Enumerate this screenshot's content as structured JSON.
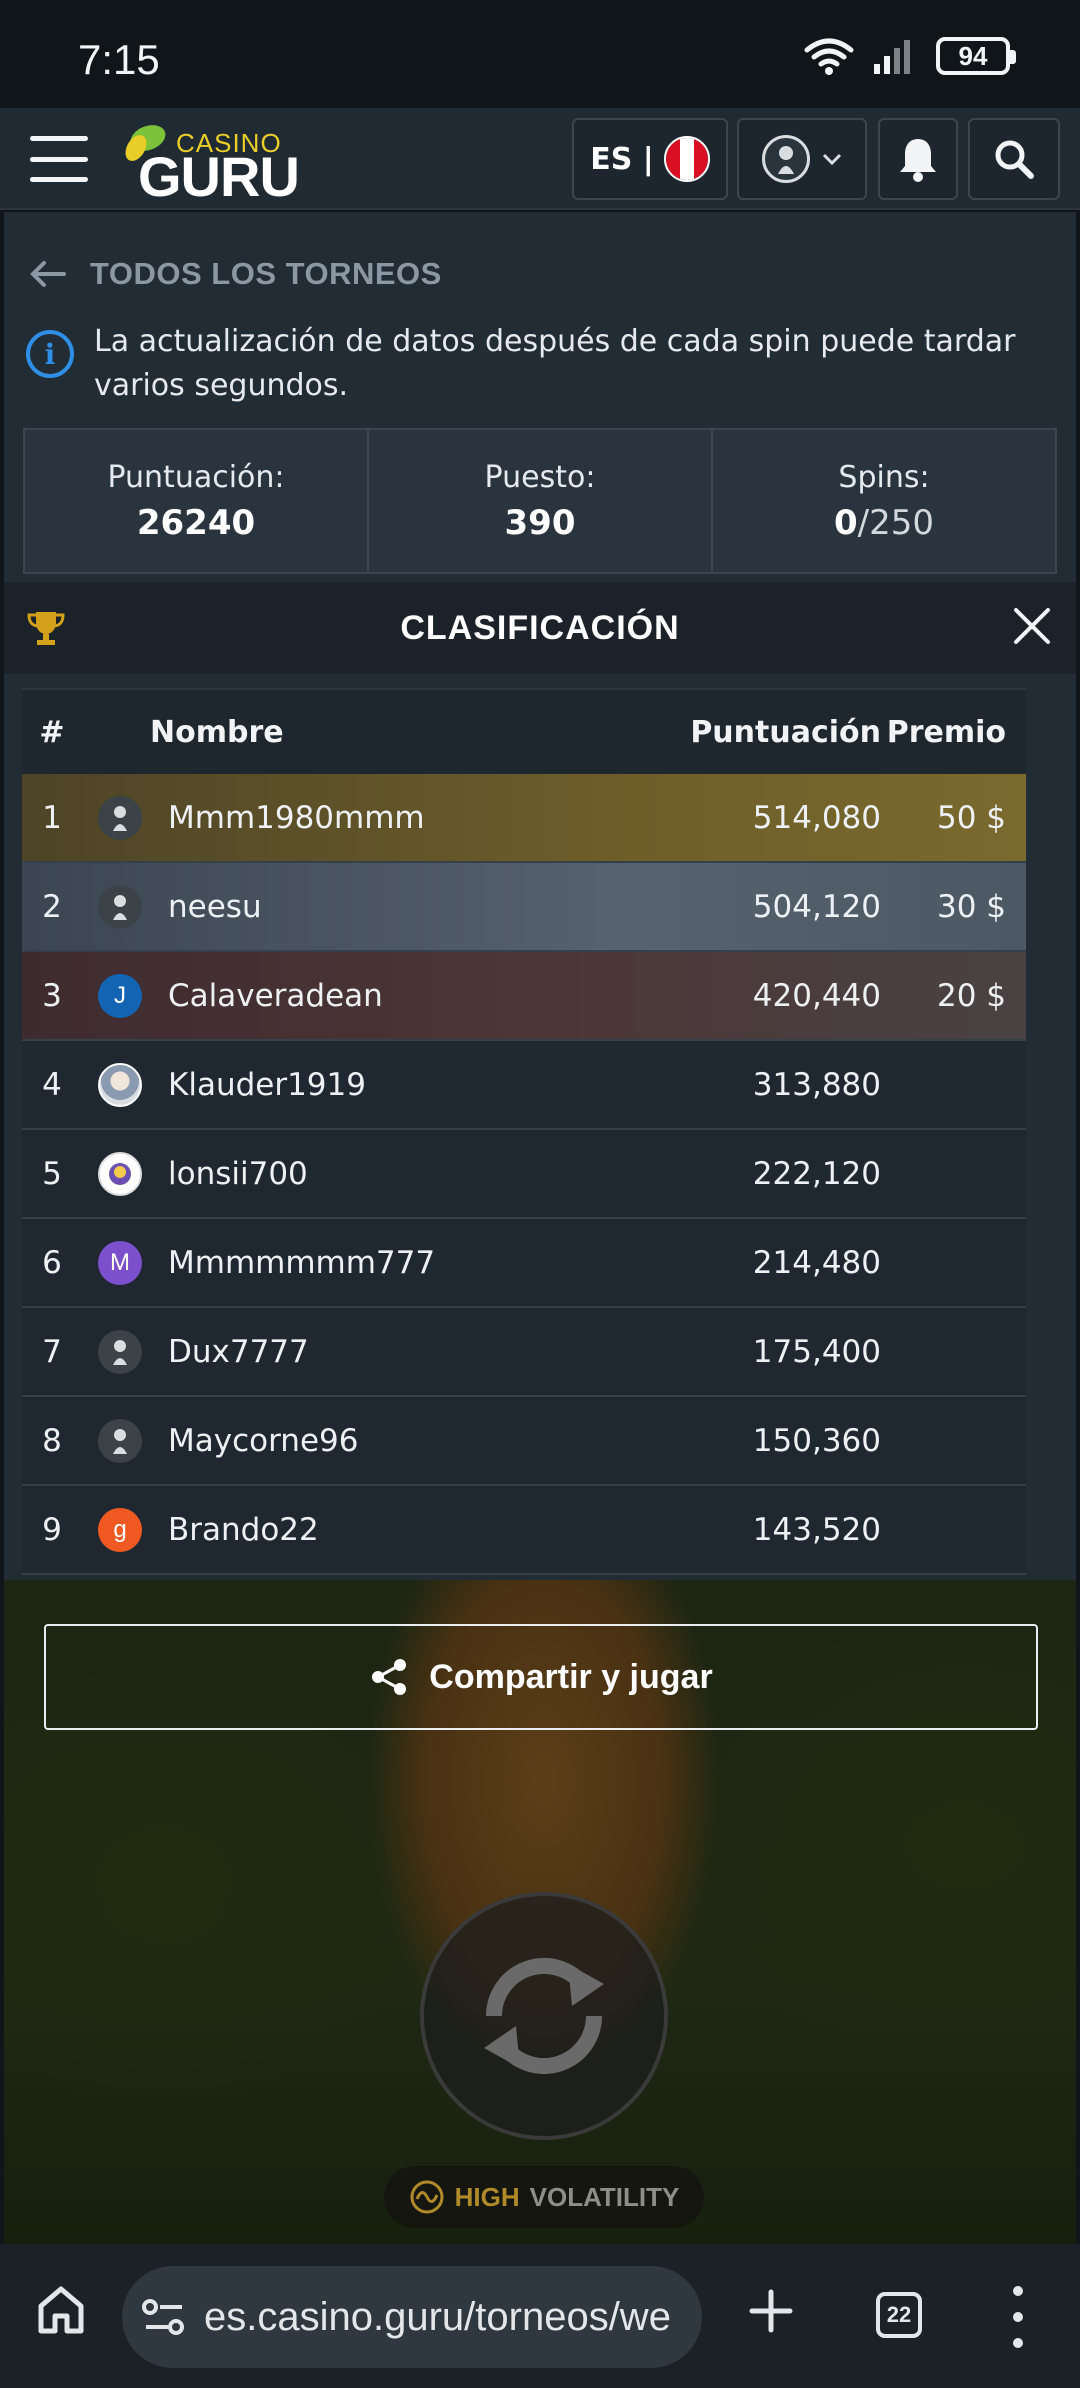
{
  "status_bar": {
    "time": "7:15",
    "battery": "94"
  },
  "header": {
    "logo_top": "CASINO",
    "logo_bottom": "GURU",
    "lang": "ES |"
  },
  "page": {
    "back_label": "TODOS LOS TORNEOS",
    "info_text": "La actualización de datos después de cada spin puede tardar varios segundos."
  },
  "stats": {
    "score_label": "Puntuación:",
    "score_value": "26240",
    "rank_label": "Puesto:",
    "rank_value": "390",
    "spins_label": "Spins:",
    "spins_used": "0",
    "spins_total": "/250"
  },
  "leaderboard": {
    "title": "CLASIFICACIÓN",
    "columns": {
      "num": "#",
      "name": "Nombre",
      "score": "Puntuación",
      "prize": "Premio"
    },
    "rows": [
      {
        "rank": "1",
        "name": "Mmm1980mmm",
        "score": "514,080",
        "prize": "50 $",
        "avatar": "default"
      },
      {
        "rank": "2",
        "name": "neesu",
        "score": "504,120",
        "prize": "30 $",
        "avatar": "default"
      },
      {
        "rank": "3",
        "name": "Calaveradean",
        "score": "420,440",
        "prize": "20 $",
        "avatar": "J"
      },
      {
        "rank": "4",
        "name": "Klauder1919",
        "score": "313,880",
        "prize": "",
        "avatar": "photo"
      },
      {
        "rank": "5",
        "name": "lonsii700",
        "score": "222,120",
        "prize": "",
        "avatar": "badge"
      },
      {
        "rank": "6",
        "name": "Mmmmmmm777",
        "score": "214,480",
        "prize": "",
        "avatar": "M"
      },
      {
        "rank": "7",
        "name": "Dux7777",
        "score": "175,400",
        "prize": "",
        "avatar": "default"
      },
      {
        "rank": "8",
        "name": "Maycorne96",
        "score": "150,360",
        "prize": "",
        "avatar": "default"
      },
      {
        "rank": "9",
        "name": "Brando22",
        "score": "143,520",
        "prize": "",
        "avatar": "g"
      }
    ]
  },
  "game": {
    "share_label": "Compartir y jugar",
    "volatility_high": "HIGH",
    "volatility_label": "VOLATILITY"
  },
  "browser": {
    "url": "es.casino.guru/torneos/we",
    "tab_count": "22"
  },
  "colors": {
    "accent_blue": "#2f8fe6",
    "logo_yellow": "#e9ce2a",
    "first_place": "#6b5c2a",
    "second_place": "#56626e",
    "third_place": "#4c3637"
  }
}
